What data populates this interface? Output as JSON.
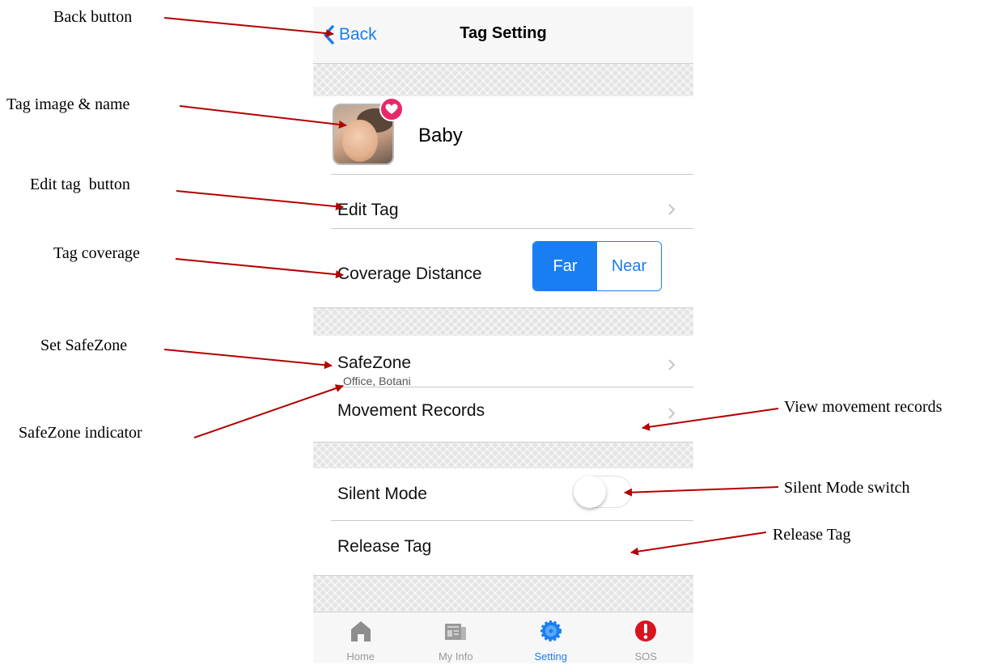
{
  "nav": {
    "back_label": "Back",
    "title": "Tag Setting"
  },
  "tag": {
    "name": "Baby",
    "image_icon": "child-photo",
    "badge_icon": "heart-icon"
  },
  "rows": {
    "edit_tag": "Edit Tag",
    "coverage": "Coverage Distance",
    "safezone": "SafeZone",
    "safezone_value": "Office, Botani",
    "movement": "Movement Records",
    "silent": "Silent Mode",
    "release": "Release Tag"
  },
  "coverage_options": [
    {
      "label": "Far",
      "selected": true
    },
    {
      "label": "Near",
      "selected": false
    }
  ],
  "silent_mode_on": false,
  "tabs": [
    {
      "label": "Home",
      "icon": "home-icon",
      "active": false
    },
    {
      "label": "My Info",
      "icon": "newspaper-icon",
      "active": false
    },
    {
      "label": "Setting",
      "icon": "gear-icon",
      "active": true
    },
    {
      "label": "SOS",
      "icon": "alert-icon",
      "active": false
    }
  ],
  "callouts": {
    "back": "Back button",
    "tag_image": "Tag image & name",
    "edit_tag": "Edit tag  button",
    "coverage": "Tag coverage",
    "set_safezone": "Set SafeZone",
    "safezone_indicator": "SafeZone indicator",
    "movement": "View movement records",
    "silent": "Silent Mode switch",
    "release": "Release Tag"
  },
  "colors": {
    "accent": "#1a7ef3",
    "arrow": "#b30000",
    "badge": "#e8286b",
    "sos": "#d9141e"
  }
}
